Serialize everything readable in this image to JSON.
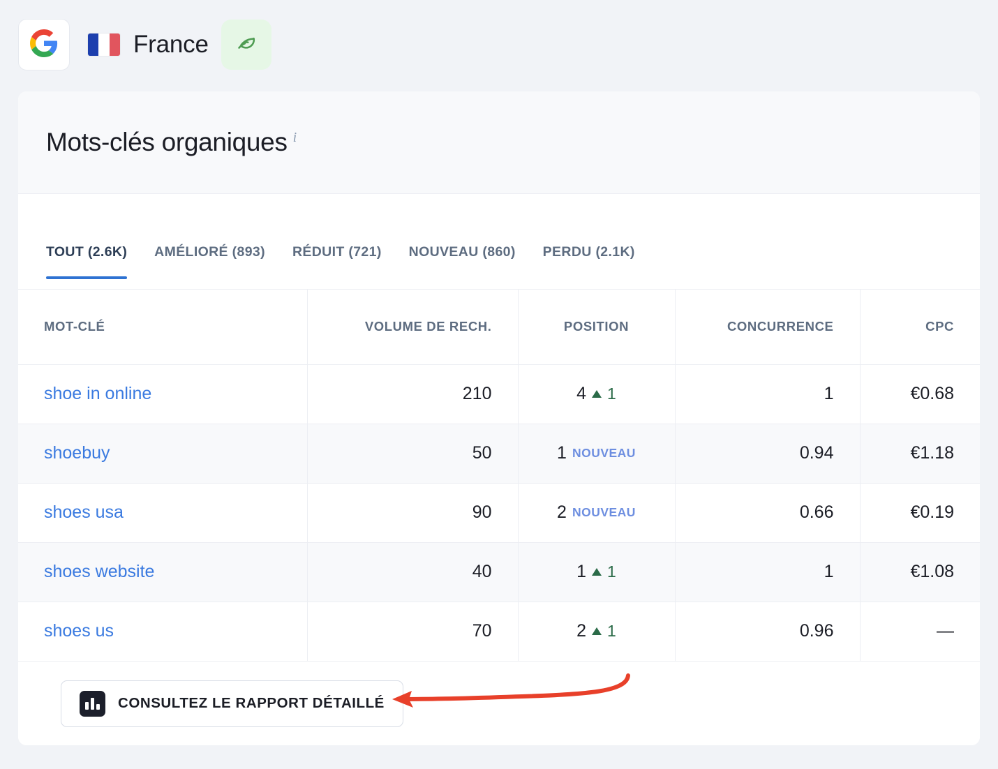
{
  "topbar": {
    "engine_icon": "google-logo-icon",
    "country_flag": "france-flag-icon",
    "country": "France",
    "organic_icon": "leaf-icon"
  },
  "card": {
    "title": "Mots-clés organiques",
    "info_tooltip_marker": "i",
    "tabs": [
      {
        "label": "TOUT (2.6K)",
        "active": true
      },
      {
        "label": "AMÉLIORÉ (893)",
        "active": false
      },
      {
        "label": "RÉDUIT (721)",
        "active": false
      },
      {
        "label": "NOUVEAU (860)",
        "active": false
      },
      {
        "label": "PERDU (2.1K)",
        "active": false
      }
    ],
    "table": {
      "columns": [
        "MOT-CLÉ",
        "VOLUME DE RECH.",
        "POSITION",
        "CONCURRENCE",
        "CPC"
      ],
      "rows": [
        {
          "keyword": "shoe in online",
          "volume": "210",
          "position": "4",
          "trend_icon": "triangle-up-icon",
          "delta": "1",
          "badge": "",
          "competition": "1",
          "cpc": "€0.68"
        },
        {
          "keyword": "shoebuy",
          "volume": "50",
          "position": "1",
          "trend_icon": "",
          "delta": "",
          "badge": "NOUVEAU",
          "competition": "0.94",
          "cpc": "€1.18"
        },
        {
          "keyword": "shoes usa",
          "volume": "90",
          "position": "2",
          "trend_icon": "",
          "delta": "",
          "badge": "NOUVEAU",
          "competition": "0.66",
          "cpc": "€0.19"
        },
        {
          "keyword": "shoes website",
          "volume": "40",
          "position": "1",
          "trend_icon": "triangle-up-icon",
          "delta": "1",
          "badge": "",
          "competition": "1",
          "cpc": "€1.08"
        },
        {
          "keyword": "shoes us",
          "volume": "70",
          "position": "2",
          "trend_icon": "triangle-up-icon",
          "delta": "1",
          "badge": "",
          "competition": "0.96",
          "cpc": "—"
        }
      ]
    },
    "footer": {
      "report_button_label": "CONSULTEZ LE RAPPORT DÉTAILLÉ",
      "report_button_icon": "bar-chart-icon"
    }
  },
  "annotation": {
    "type": "curved-arrow",
    "color": "#e8402a",
    "points_to": "report-detail-button"
  },
  "colors": {
    "page_bg": "#f1f3f7",
    "card_bg": "#ffffff",
    "header_bg": "#f8f9fb",
    "accent_blue": "#2e72d2",
    "link_blue": "#3a7ae0",
    "badge_blue": "#6d8ee0",
    "trend_green": "#2b6b48",
    "annotation_red": "#e8402a",
    "leaf_green": "#4e9c52",
    "leaf_bg": "#e6f7e6"
  }
}
